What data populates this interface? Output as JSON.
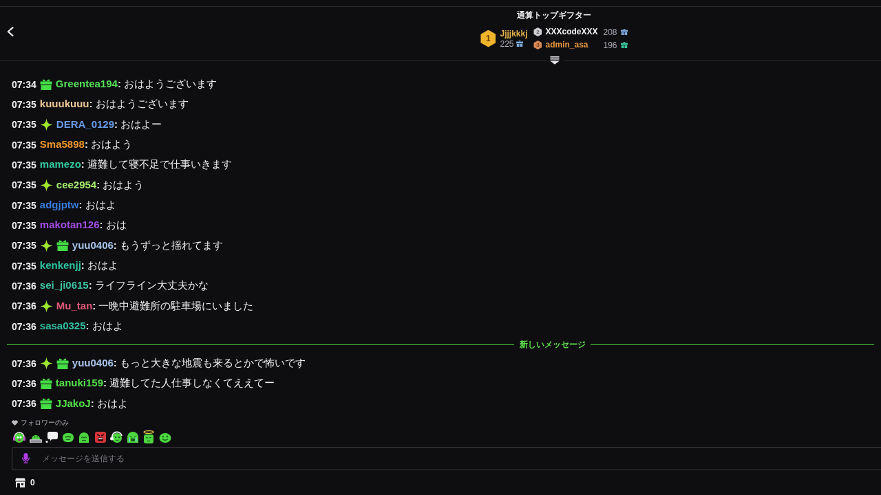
{
  "header": {
    "title": "通算トップギフター"
  },
  "top_gifters": [
    {
      "rank": "1",
      "name": "Jjjjkkkj",
      "count": "225",
      "color": "#e8b44e",
      "gift": {
        "color": "#7eaee0"
      }
    },
    {
      "rank": "2",
      "name": "XXXcodeXXX",
      "count": "208",
      "color": "#f2f2f2",
      "gift": {
        "color": "#7eaee0"
      }
    },
    {
      "rank": "3",
      "name": "admin_asa",
      "count": "196",
      "color": "#e8963c",
      "gift": {
        "color": "#3cc8a0"
      }
    }
  ],
  "chat": {
    "messages": [
      {
        "time": "07:34",
        "badges": [
          {
            "kind": "gift"
          }
        ],
        "user": "Greentea194",
        "color": "#55e05a",
        "text": "**:** おはようございます"
      },
      {
        "time": "07:35",
        "user": "kuuukuuu",
        "color": "#f0c896",
        "text": "**:** おはようございます"
      },
      {
        "time": "07:35",
        "badges": [
          {
            "kind": "sparkle"
          }
        ],
        "user": "DERA_0129",
        "color": "#6a9ce8",
        "text": "**:** おはよー"
      },
      {
        "time": "07:35",
        "user": "Sma5898",
        "color": "#f0962c",
        "text": "**:** おはよう"
      },
      {
        "time": "07:35",
        "user": "mamezo",
        "color": "#34c8a0",
        "text": "**:** 避難して寝不足で仕事いきます"
      },
      {
        "time": "07:35",
        "badges": [
          {
            "kind": "sparkle"
          }
        ],
        "user": "cee2954",
        "color": "#a4ec6c",
        "text": "**:** おはよう"
      },
      {
        "time": "07:35",
        "user": "adgjptw",
        "color": "#3a7ce0",
        "text": "**:** おはよ"
      },
      {
        "time": "07:35",
        "user": "makotan126",
        "color": "#a44ce6",
        "text": "**:** おは"
      },
      {
        "time": "07:35",
        "badges": [
          {
            "kind": "sparkle"
          },
          {
            "kind": "gift"
          }
        ],
        "user": "yuu0406",
        "color": "#a8c4ec",
        "text": "**:** もうずっと揺れてます"
      },
      {
        "time": "07:35",
        "user": "kenkenjj",
        "color": "#2cc4a0",
        "text": "**:** おはよ"
      },
      {
        "time": "07:36",
        "user": "sei_ji0615",
        "color": "#3cc4a4",
        "text": "**:** ライフライン大丈夫かな"
      },
      {
        "time": "07:36",
        "badges": [
          {
            "kind": "sparkle"
          }
        ],
        "user": "Mu_tan",
        "color": "#e0587a",
        "text": "**:** 一晩中避難所の駐車場にいました"
      },
      {
        "time": "07:36",
        "user": "sasa0325",
        "color": "#30c0a0",
        "text": "**:** おはよ"
      }
    ],
    "new_divider": {
      "label": "新しいメッセージ"
    },
    "new_messages": [
      {
        "time": "07:36",
        "badges": [
          {
            "kind": "sparkle"
          },
          {
            "kind": "gift"
          }
        ],
        "user": "yuu0406",
        "color": "#a8c4ec",
        "text": "**:** もっと大きな地震も来るとかで怖いです"
      },
      {
        "time": "07:36",
        "badges": [
          {
            "kind": "gift"
          }
        ],
        "user": "tanuki159",
        "color": "#55e04a",
        "text": "**:** 避難してた人仕事しなくてええてー"
      },
      {
        "time": "07:36",
        "badges": [
          {
            "kind": "gift"
          }
        ],
        "user": "JJakoJ",
        "color": "#55e04a",
        "text": "**:** おはよ"
      }
    ]
  },
  "footer": {
    "mode_label": "フォロワーのみ",
    "input": {
      "placeholder": "メッセージを送信する"
    },
    "points": "0"
  }
}
